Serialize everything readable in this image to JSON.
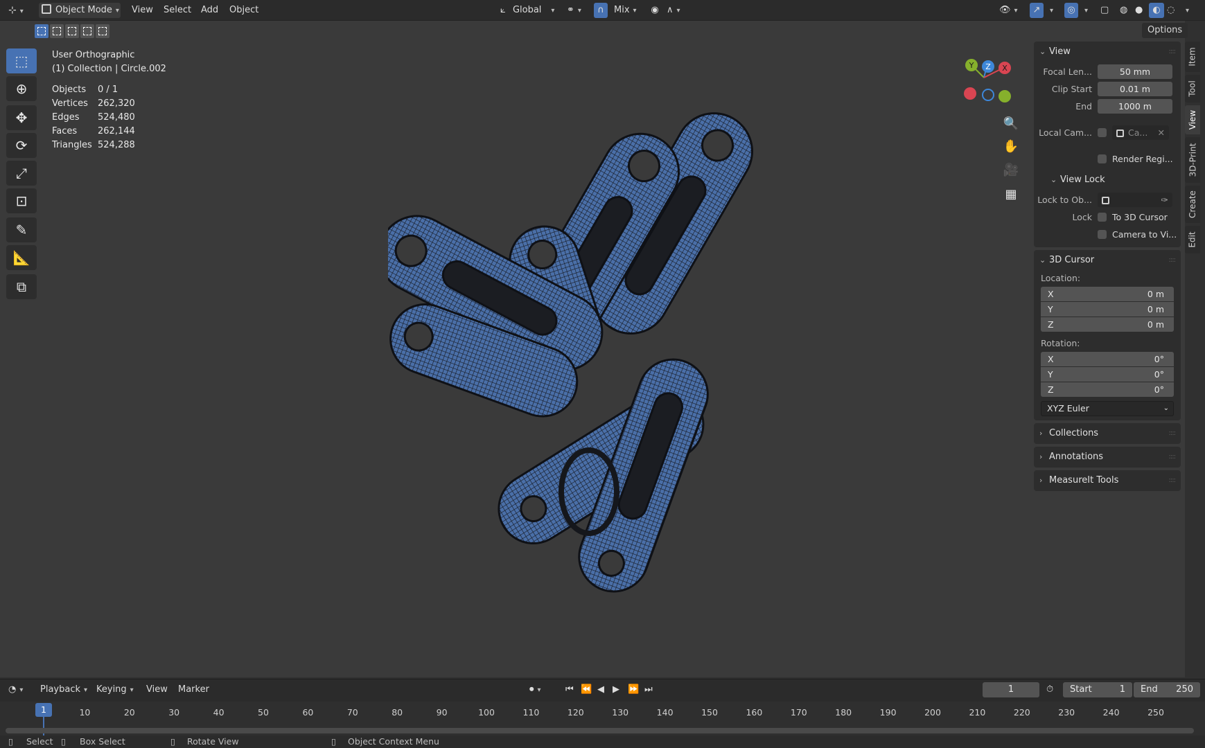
{
  "header": {
    "mode_label": "Object Mode",
    "menus": [
      "View",
      "Select",
      "Add",
      "Object"
    ],
    "transform_orientation": "Global",
    "snap_mode": "Mix",
    "options_label": "Options"
  },
  "overlay": {
    "view_name": "User Orthographic",
    "collection_line": "(1) Collection | Circle.002",
    "stats": [
      {
        "k": "Objects",
        "v": "0 / 1"
      },
      {
        "k": "Vertices",
        "v": "262,320"
      },
      {
        "k": "Edges",
        "v": "524,480"
      },
      {
        "k": "Faces",
        "v": "262,144"
      },
      {
        "k": "Triangles",
        "v": "524,288"
      }
    ]
  },
  "gizmo": {
    "y": "Y",
    "z": "Z",
    "x": "X"
  },
  "npanel": {
    "view": {
      "title": "View",
      "focal_label": "Focal Len...",
      "focal_value": "50 mm",
      "clip_start_label": "Clip Start",
      "clip_start_value": "0.01 m",
      "end_label": "End",
      "end_value": "1000 m",
      "local_cam_label": "Local Cam...",
      "local_cam_value": "Ca...",
      "render_region": "Render Regi...",
      "view_lock_title": "View Lock",
      "lock_to_obj_label": "Lock to Ob...",
      "lock_label": "Lock",
      "to_3d_cursor": "To 3D Cursor",
      "camera_to_view": "Camera to Vi..."
    },
    "cursor": {
      "title": "3D Cursor",
      "location_label": "Location:",
      "loc": [
        {
          "axis": "X",
          "val": "0 m"
        },
        {
          "axis": "Y",
          "val": "0 m"
        },
        {
          "axis": "Z",
          "val": "0 m"
        }
      ],
      "rotation_label": "Rotation:",
      "rot": [
        {
          "axis": "X",
          "val": "0°"
        },
        {
          "axis": "Y",
          "val": "0°"
        },
        {
          "axis": "Z",
          "val": "0°"
        }
      ],
      "rotation_mode": "XYZ Euler"
    },
    "collapsed": [
      "Collections",
      "Annotations",
      "MeasureIt Tools"
    ]
  },
  "side_tabs": [
    "Item",
    "Tool",
    "View",
    "3D-Print",
    "Create",
    "Edit"
  ],
  "timeline": {
    "menus": [
      "Playback",
      "Keying",
      "View",
      "Marker"
    ],
    "current_frame": "1",
    "start_label": "Start",
    "start_value": "1",
    "end_label": "End",
    "end_value": "250",
    "ticks": [
      "1",
      "10",
      "20",
      "30",
      "40",
      "50",
      "60",
      "70",
      "80",
      "90",
      "100",
      "110",
      "120",
      "130",
      "140",
      "150",
      "160",
      "170",
      "180",
      "190",
      "200",
      "210",
      "220",
      "230",
      "240",
      "250"
    ]
  },
  "statusbar": {
    "select": "Select",
    "box_select": "Box Select",
    "rotate_view": "Rotate View",
    "context_menu": "Object Context Menu"
  },
  "colors": {
    "accent": "#4772b3",
    "mesh": "#4a6fa8",
    "gizmo_x": "#d94552",
    "gizmo_y": "#86b02c",
    "gizmo_z": "#3d87d9"
  }
}
